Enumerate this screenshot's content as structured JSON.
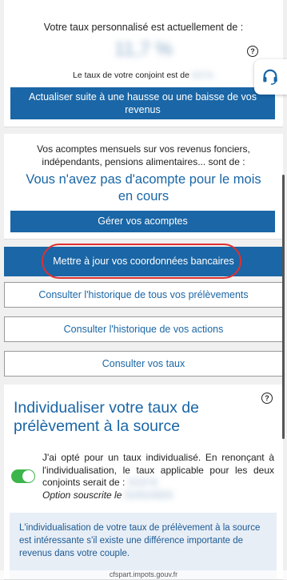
{
  "taux": {
    "label": "Votre taux personnalisé est actuellement de :",
    "value": "11,7 %",
    "conjoint_label": "Le taux de votre conjoint est de",
    "conjoint_value": "9,9 %",
    "update_button": "Actualiser suite à une hausse ou une baisse de vos revenus"
  },
  "acomptes": {
    "description": "Vos acomptes mensuels sur vos revenus fonciers, indépendants, pensions alimentaires... sont de :",
    "status": "Vous n'avez pas d'acompte pour le mois en cours",
    "manage_button": "Gérer vos acomptes"
  },
  "actions": {
    "bank_details": "Mettre à jour vos coordonnées bancaires",
    "history_withdrawals": "Consulter l'historique de tous vos prélèvements",
    "history_actions": "Consulter l'historique de vos actions",
    "rates": "Consulter vos taux"
  },
  "individualisation": {
    "title": "Individualiser votre taux de prélèvement à la source",
    "text": "J'ai opté pour un taux individualisé. En renonçant à l'individualisation, le taux applicable pour les deux conjoints serait de :",
    "rate_blurred": "10,8 %",
    "option_label": "Option souscrite le",
    "option_date_blurred": "01/01/2023",
    "info": "L'individualisation de votre taux de prélèvement à la source est intéressante s'il existe une différence importante de revenus dans votre couple."
  },
  "footer": {
    "url": "cfspart.impots.gouv.fr"
  },
  "colors": {
    "primary": "#1a66a6",
    "toggle_on": "#3cb54a",
    "highlight": "#e03030"
  }
}
